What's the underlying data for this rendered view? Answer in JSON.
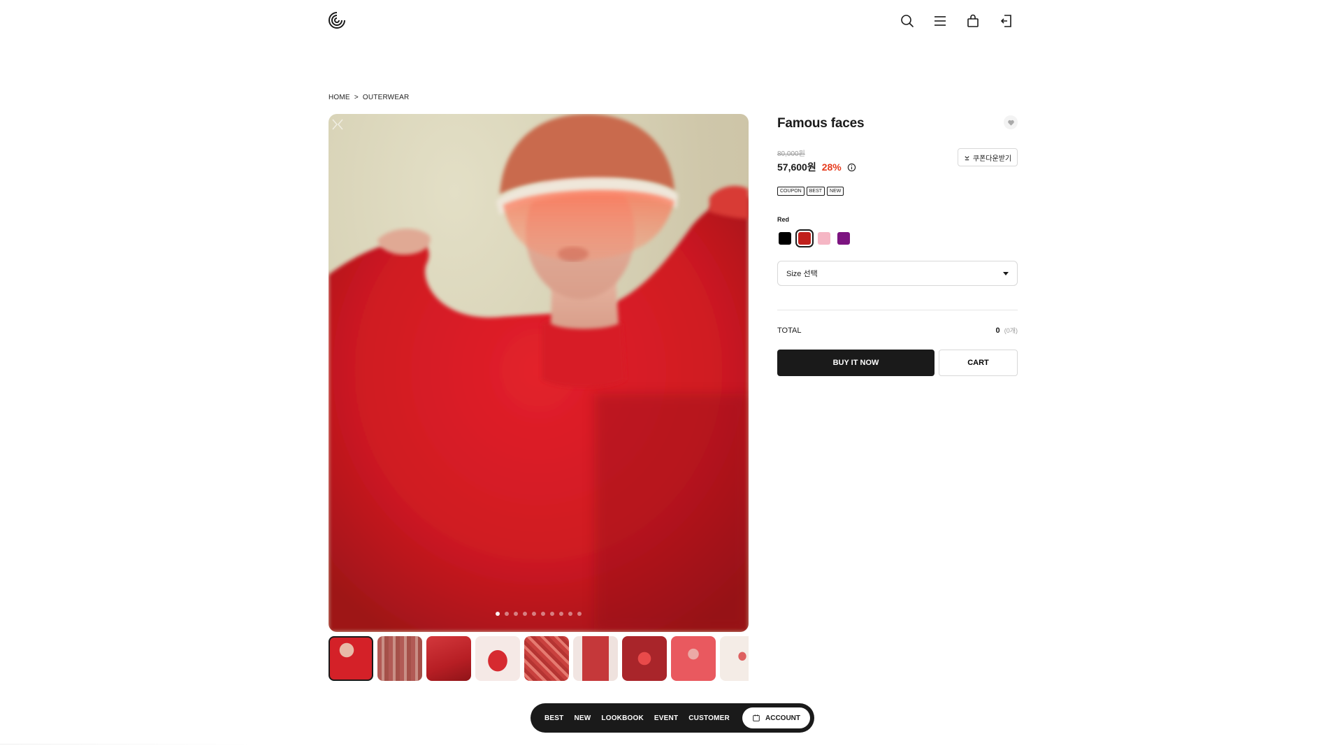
{
  "header": {
    "logo_icon": "swirl-logo-icon",
    "icons": [
      "search-icon",
      "menu-icon",
      "bag-icon",
      "login-icon"
    ]
  },
  "breadcrumb": {
    "home": "HOME",
    "separator": ">",
    "current": "OUTERWEAR"
  },
  "gallery": {
    "prev_icon": "chevron-left-icon",
    "next_icon": "chevron-right-icon",
    "dot_count": 10,
    "active_dot": 0,
    "thumbnail_count": 9,
    "active_thumbnail": 0
  },
  "product": {
    "title": "Famous faces",
    "original_price": "80,000원",
    "price": "57,600원",
    "discount": "28%",
    "coupon_button": "쿠폰다운받기",
    "badges": [
      "COUPON",
      "BEST",
      "NEW"
    ],
    "color_label": "Red",
    "colors": [
      {
        "name": "black",
        "hex": "#000000"
      },
      {
        "name": "red",
        "hex": "#c0201c"
      },
      {
        "name": "pink",
        "hex": "#f5b6c4"
      },
      {
        "name": "purple",
        "hex": "#7c1480"
      }
    ],
    "selected_color": 1,
    "size_placeholder": "Size 선택",
    "total_label": "TOTAL",
    "total_value": "0",
    "total_count": "(0개)",
    "buy_button": "BUY IT NOW",
    "cart_button": "CART"
  },
  "bottom_nav": {
    "items": [
      "BEST",
      "NEW",
      "LOOKBOOK",
      "EVENT",
      "CUSTOMER"
    ],
    "account_label": "ACCOUNT"
  },
  "colors": {
    "accent_discount": "#e63a1c",
    "button_dark": "#1a1a1a"
  }
}
